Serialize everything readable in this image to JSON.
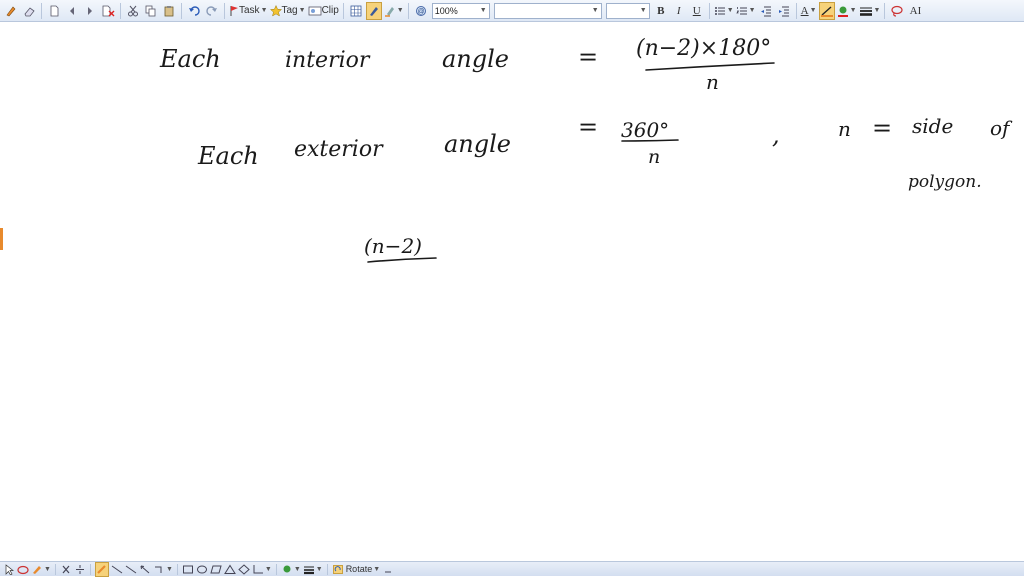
{
  "toolbar": {
    "task_label": "Task",
    "tag_label": "Tag",
    "clip_label": "Clip",
    "zoom_value": "100%",
    "font_name_value": "",
    "font_size_value": "",
    "bold_label": "B",
    "italic_label": "I",
    "underline_label": "U",
    "text_color_label": "A",
    "superscript_label": "AI"
  },
  "bottombar": {
    "rotate_label": "Rotate"
  },
  "notes": {
    "line1": {
      "lhs_word1": "Each",
      "lhs_word2": "interior",
      "lhs_word3": "angle",
      "eq": "=",
      "numerator": "(n−2)×180°",
      "denominator": "n"
    },
    "line2": {
      "lhs_word1": "Each",
      "lhs_word2": "exterior",
      "lhs_word3": "angle",
      "eq": "=",
      "numerator": "360°",
      "denominator": "n",
      "comma": ",",
      "def_n": "n",
      "def_eq": "=",
      "def_word1": "side",
      "def_word2": "of",
      "def_word3": "polygon."
    },
    "line3": {
      "expr": "(n−2)"
    }
  },
  "colors": {
    "toolbar_bg": "#dfe8f5",
    "ink": "#1a1a1a",
    "accent_orange": "#e88a2d"
  }
}
